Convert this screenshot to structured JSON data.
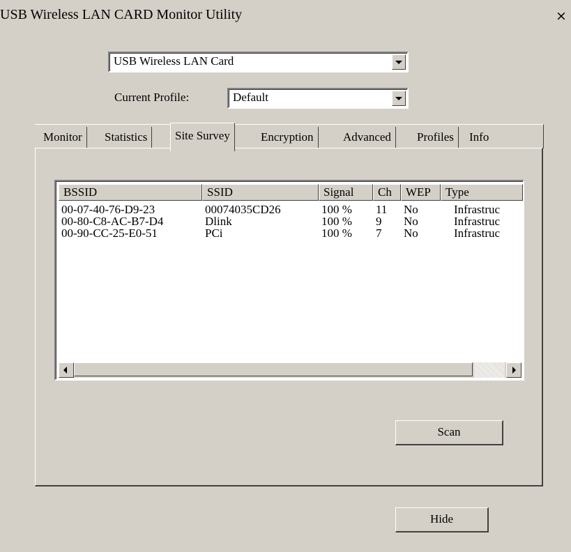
{
  "window": {
    "title": "USB Wireless LAN CARD Monitor Utility",
    "close_glyph": "×"
  },
  "adapter": {
    "selected": "USB Wireless LAN Card"
  },
  "profile": {
    "label": "Current Profile:",
    "selected": "Default"
  },
  "tabs": [
    {
      "label": "Monitor",
      "active": false
    },
    {
      "label": "Statistics",
      "active": false
    },
    {
      "label": "Site Survey",
      "active": true
    },
    {
      "label": "Encryption",
      "active": false
    },
    {
      "label": "Advanced",
      "active": false
    },
    {
      "label": "Profiles",
      "active": false
    },
    {
      "label": "Info",
      "active": false
    }
  ],
  "site_survey": {
    "columns": [
      "BSSID",
      "SSID",
      "Signal",
      "Ch",
      "WEP",
      "Type"
    ],
    "rows": [
      {
        "bssid": "00-07-40-76-D9-23",
        "ssid": "00074035CD26",
        "signal": "100 %",
        "ch": "11",
        "wep": "No",
        "type": "Infrastruc"
      },
      {
        "bssid": "00-80-C8-AC-B7-D4",
        "ssid": "Dlink",
        "signal": "100 %",
        "ch": "9",
        "wep": "No",
        "type": "Infrastruc"
      },
      {
        "bssid": "00-90-CC-25-E0-51",
        "ssid": "PCi",
        "signal": "100 %",
        "ch": "7",
        "wep": "No",
        "type": "Infrastruc"
      }
    ]
  },
  "buttons": {
    "scan": "Scan",
    "hide": "Hide"
  }
}
